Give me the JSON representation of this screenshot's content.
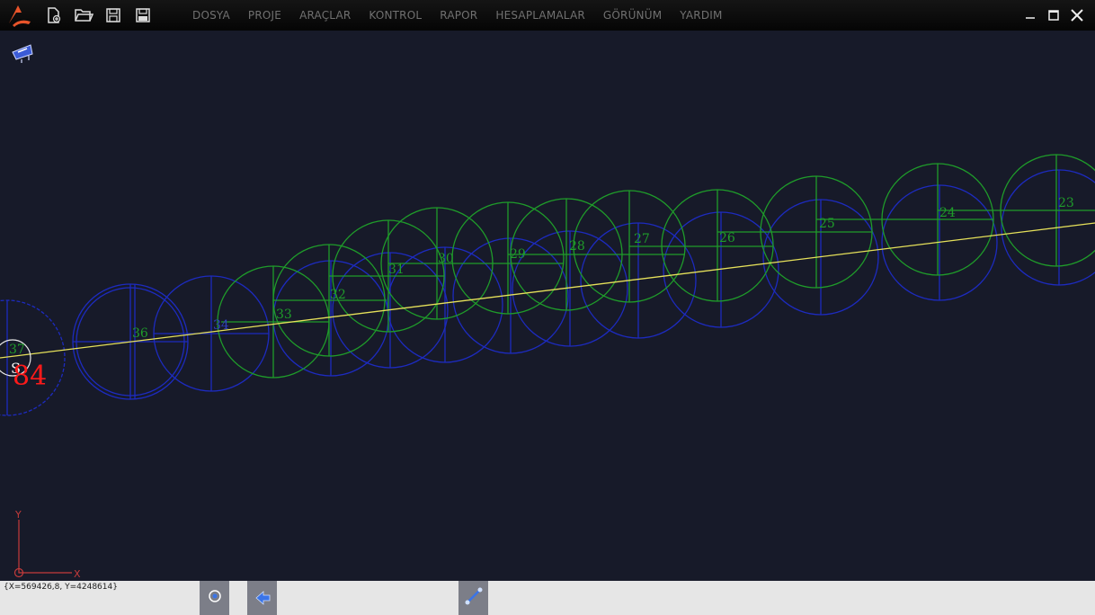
{
  "menu": [
    "DOSYA",
    "PROJE",
    "ARAÇLAR",
    "KONTROL",
    "RAPOR",
    "HESAPLAMALAR",
    "GÖRÜNÜM",
    "YARDIM"
  ],
  "toolbar_icons": [
    "new-file-icon",
    "open-folder-icon",
    "save-icon",
    "save-as-icon"
  ],
  "canvas": {
    "station_labels": [
      {
        "text": "23",
        "color": "green"
      },
      {
        "text": "24",
        "color": "green"
      },
      {
        "text": "25",
        "color": "green"
      },
      {
        "text": "26",
        "color": "green"
      },
      {
        "text": "27",
        "color": "green"
      },
      {
        "text": "28",
        "color": "green"
      },
      {
        "text": "29",
        "color": "green"
      },
      {
        "text": "30",
        "color": "green"
      },
      {
        "text": "31",
        "color": "green"
      },
      {
        "text": "32",
        "color": "green"
      },
      {
        "text": "33",
        "color": "green"
      },
      {
        "text": "34",
        "color": "blue"
      },
      {
        "text": "36",
        "color": "green"
      },
      {
        "text": "37",
        "color": "green"
      }
    ],
    "start_label": "S",
    "start_number": "84",
    "axis_y": "Y",
    "axis_x": "X",
    "colors": {
      "green": "#1f9c2a",
      "blue": "#1d2bbf",
      "alignment": "#e6e15a",
      "start": "#ff1a1a"
    }
  },
  "status": {
    "coordinates": "{X=569426,8, Y=4248614}"
  }
}
